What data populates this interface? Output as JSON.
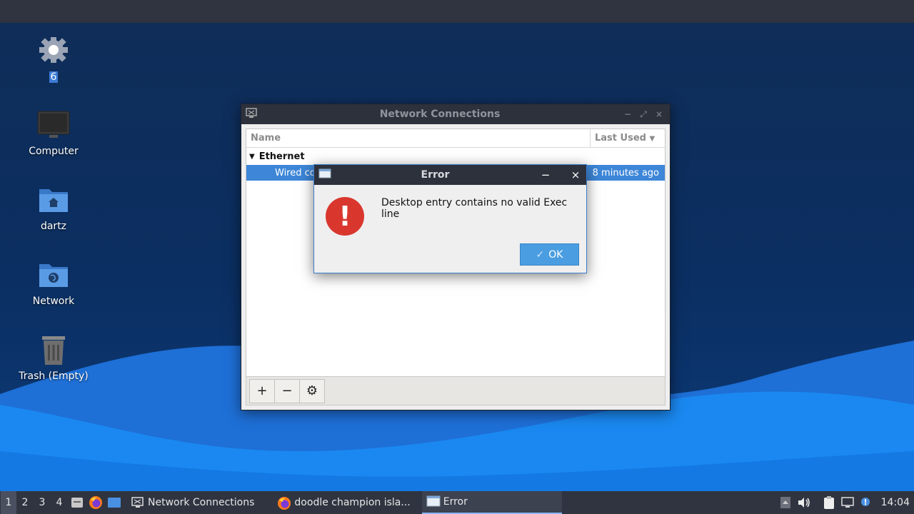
{
  "desktop": {
    "icons": [
      {
        "label": "6",
        "icon": "gear-icon"
      },
      {
        "label": "Computer",
        "icon": "monitor-icon"
      },
      {
        "label": "dartz",
        "icon": "home-folder-icon"
      },
      {
        "label": "Network",
        "icon": "network-folder-icon"
      },
      {
        "label": "Trash (Empty)",
        "icon": "trash-icon"
      }
    ]
  },
  "network_window": {
    "title": "Network Connections",
    "columns": {
      "name": "Name",
      "last_used": "Last Used"
    },
    "group": "Ethernet",
    "connection": {
      "name": "Wired co",
      "last_used": "8 minutes ago"
    },
    "toolbar": {
      "add": "+",
      "remove": "−",
      "settings": "⚙"
    }
  },
  "error_dialog": {
    "title": "Error",
    "minimize": "−",
    "close": "×",
    "message": "Desktop entry contains no valid Exec line",
    "ok_label": "OK",
    "ok_check": "✓"
  },
  "taskbar": {
    "workspaces": [
      "1",
      "2",
      "3",
      "4"
    ],
    "tasks": [
      {
        "label": "Network Connections",
        "icon": "network-manager-icon"
      },
      {
        "label": "doodle champion isla...",
        "icon": "firefox-icon"
      },
      {
        "label": "Error",
        "icon": "window-icon"
      }
    ],
    "clock": "14:04"
  },
  "colors": {
    "accent": "#3d86d8",
    "error_red": "#d9372e",
    "panel": "#2f3440"
  }
}
